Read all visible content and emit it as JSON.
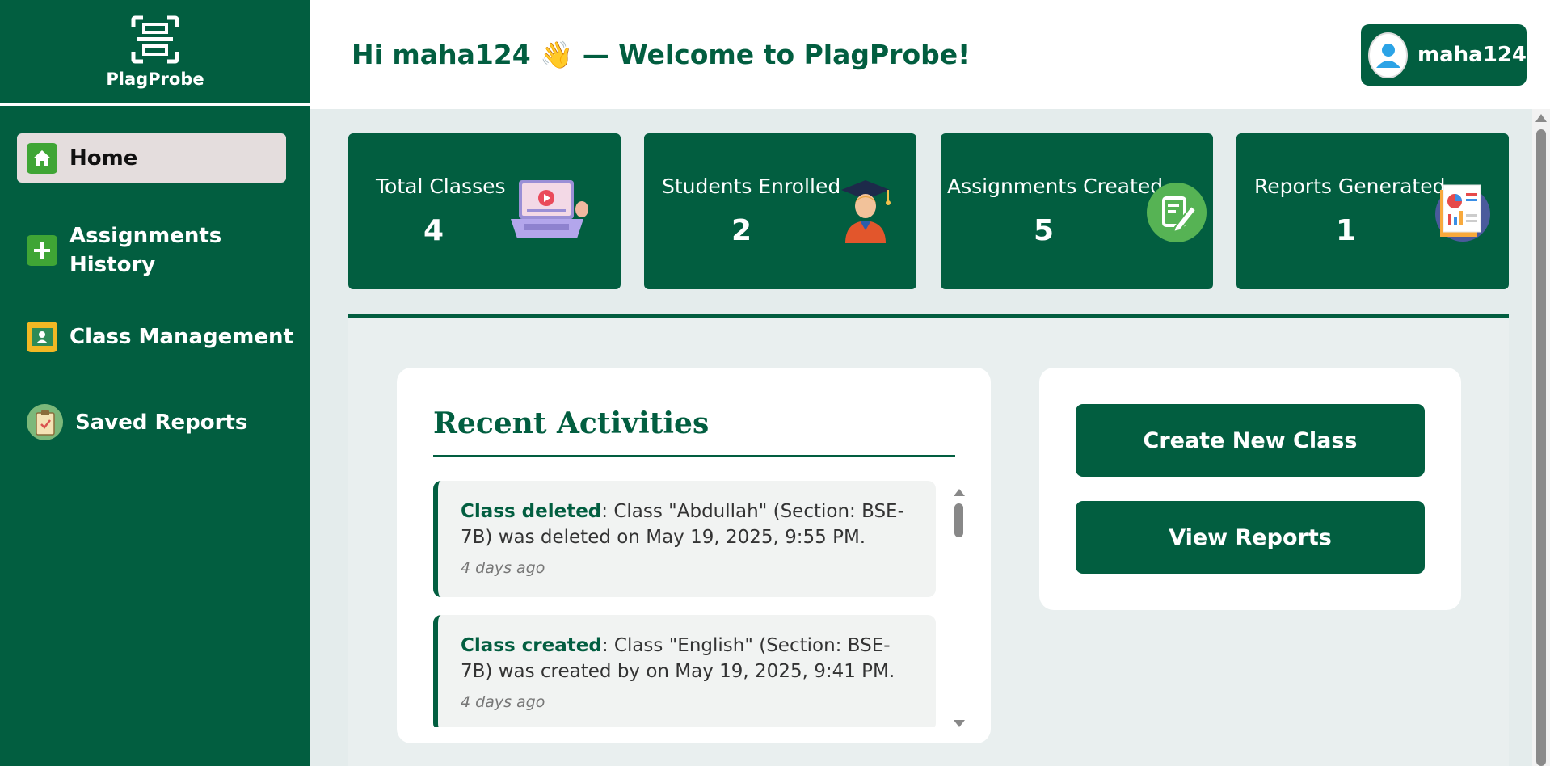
{
  "sidebar": {
    "brand": "PlagProbe",
    "items": [
      {
        "label": "Home",
        "icon": "home-icon",
        "active": true
      },
      {
        "label": "Assignments\nHistory",
        "line1": "Assignments",
        "line2": "History",
        "icon": "plus-icon"
      },
      {
        "label": "Class Management",
        "icon": "classroom-board-icon"
      },
      {
        "label": "Saved Reports",
        "icon": "clipboard-icon"
      }
    ]
  },
  "header": {
    "greeting": "Hi maha124 👋 — Welcome to PlagProbe!",
    "user_name": "maha124"
  },
  "stats": [
    {
      "label": "Total Classes",
      "value": "4",
      "icon": "laptop-video-icon"
    },
    {
      "label": "Students Enrolled",
      "value": "2",
      "icon": "graduate-student-icon"
    },
    {
      "label": "Assignments Created",
      "value": "5",
      "icon": "edit-document-icon"
    },
    {
      "label": "Reports Generated",
      "value": "1",
      "icon": "report-chart-icon"
    }
  ],
  "activities": {
    "title": "Recent Activities",
    "items": [
      {
        "type": "Class deleted",
        "text": ": Class \"Abdullah\" (Section: BSE-7B) was deleted on May 19, 2025, 9:55 PM.",
        "time": "4 days ago"
      },
      {
        "type": "Class created",
        "text": ": Class \"English\" (Section: BSE-7B) was created by on May 19, 2025, 9:41 PM.",
        "time": "4 days ago"
      }
    ]
  },
  "actions": {
    "create_class": "Create New Class",
    "view_reports": "View Reports"
  },
  "colors": {
    "primary": "#025e40",
    "active_nav_bg": "#e4dddd",
    "page_bg": "#e4ecec"
  }
}
